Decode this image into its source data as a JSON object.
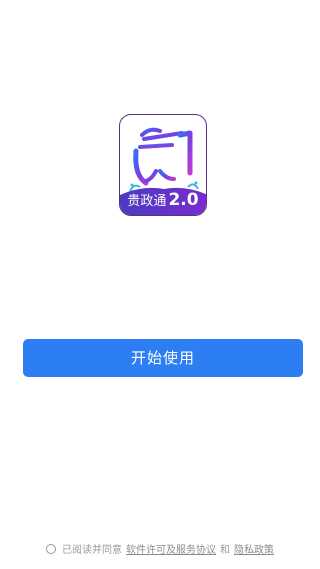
{
  "logo": {
    "title": "贵政通",
    "version": "2.0"
  },
  "start_button": {
    "label": "开始使用"
  },
  "agreement": {
    "prefix": "已阅读并同意",
    "software_license_link": "软件许可及服务协议",
    "conjunction": "和",
    "privacy_link": "隐私政策"
  },
  "colors": {
    "primary": "#2d7ef3",
    "logo_purple": "#5a2f86",
    "muted_text": "#9a9a9a"
  }
}
